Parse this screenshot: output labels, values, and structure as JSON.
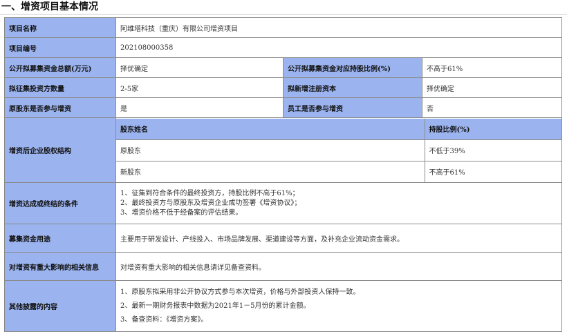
{
  "section": {
    "title": "一、增资项目基本情况"
  },
  "rows": {
    "project_name": {
      "label": "项目名称",
      "value": "阿维塔科技（重庆）有限公司增资项目"
    },
    "project_code": {
      "label": "项目编号",
      "value": "202108000358"
    },
    "amount": {
      "label": "公开拟募集资金总额(万元)",
      "value": "择优确定",
      "label2": "公开拟募集资金对应持股比例(%)",
      "value2": "不高于61%"
    },
    "investors": {
      "label": "拟征集投资方数量",
      "value": "2-5家",
      "label2": "拟新增注册资本",
      "value2": "择优确定"
    },
    "shareholders": {
      "label": "原股东是否参与增资",
      "value": "是",
      "label2": "员工是否参与增资",
      "value2": "否"
    },
    "structure": {
      "label": "增资后企业股权结构",
      "header": [
        "股东姓名",
        "持股比例(%)"
      ],
      "items": [
        {
          "name": "原股东",
          "ratio": "不低于39%"
        },
        {
          "name": "新股东",
          "ratio": "不高于61%"
        }
      ]
    },
    "conditions": {
      "label": "增资达成或终结的条件",
      "lines": [
        "1、征集到符合条件的最终投资方，持股比例不高于61%；",
        "2、最终投资方与原股东及增资企业成功签署《增资协议》；",
        "3、增资价格不低于经备案的评估结果。"
      ]
    },
    "usage": {
      "label": "募集资金用途",
      "value": "主要用于研发设计、产线投入、市场品牌发展、渠道建设等方面，及补充企业流动资金需求。"
    },
    "impact": {
      "label": "对增资有重大影响的相关信息",
      "value": "对增资有重大影响的相关信息请详见备查资料。"
    },
    "other": {
      "label": "其他披露的内容",
      "lines": [
        "1、原股东拟采用非公开协议方式参与本次增资，价格与外部投资人保持一致。",
        "2、最新一期财务报表中数据为2021年1－5月份的累计金额。",
        "3、备查资料：《增资方案》。"
      ]
    }
  }
}
